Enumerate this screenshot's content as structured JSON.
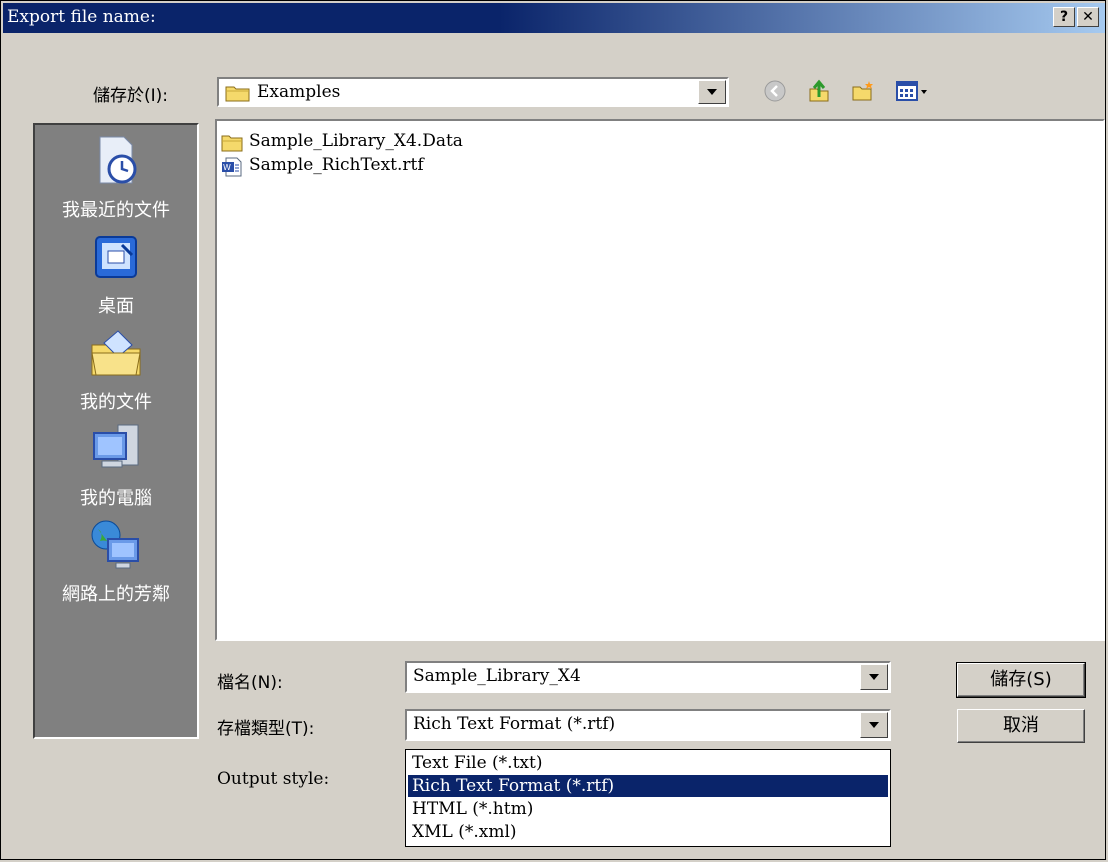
{
  "title": "Export file name:",
  "titlebar_buttons": {
    "help": "?",
    "close": "✕"
  },
  "save_in": {
    "label": "儲存於(I):",
    "value": "Examples"
  },
  "toolbar_icons": [
    "back-icon",
    "up-folder-icon",
    "new-folder-icon",
    "view-menu-icon"
  ],
  "places": [
    {
      "label": "我最近的文件",
      "icon": "recent-documents-icon"
    },
    {
      "label": "桌面",
      "icon": "desktop-icon"
    },
    {
      "label": "我的文件",
      "icon": "my-documents-icon"
    },
    {
      "label": "我的電腦",
      "icon": "my-computer-icon"
    },
    {
      "label": "網路上的芳鄰",
      "icon": "network-places-icon"
    }
  ],
  "files": [
    {
      "name": "Sample_Library_X4.Data",
      "icon": "folder-icon"
    },
    {
      "name": "Sample_RichText.rtf",
      "icon": "rtf-document-icon"
    }
  ],
  "filename": {
    "label": "檔名(N):",
    "value": "Sample_Library_X4"
  },
  "filetype": {
    "label": "存檔類型(T):",
    "value": "Rich Text Format (*.rtf)"
  },
  "output_style": {
    "label": "Output style:"
  },
  "filetype_options": [
    "Text File (*.txt)",
    "Rich Text Format (*.rtf)",
    "HTML (*.htm)",
    "XML (*.xml)"
  ],
  "selected_option_index": 1,
  "buttons": {
    "save": "儲存(S)",
    "cancel": "取消"
  },
  "colors": {
    "title_active": "#0a246a",
    "title_fade": "#a6caf0",
    "face": "#d4d0c8",
    "selection": "#0a246a"
  }
}
